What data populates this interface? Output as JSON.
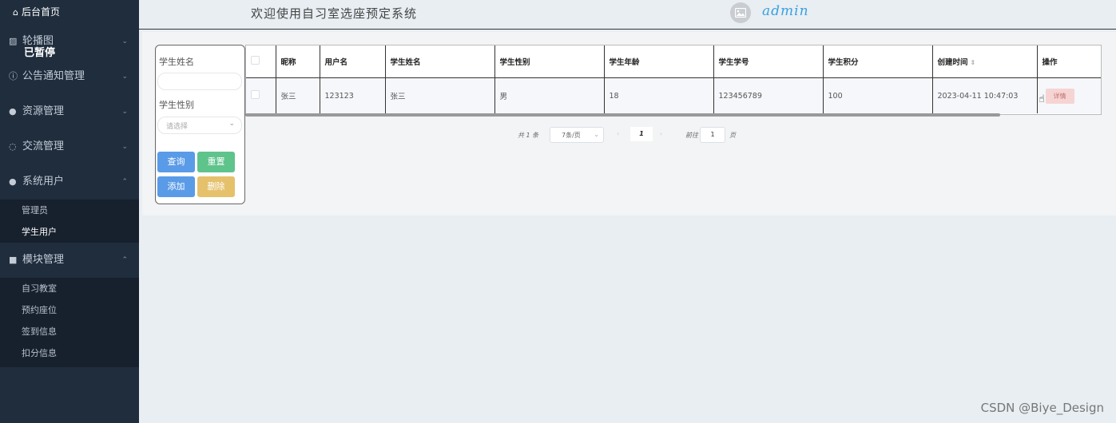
{
  "sidebar": {
    "home": "后台首页",
    "paused": "已暂停",
    "groups": [
      {
        "label": "轮播图",
        "icon": "image-icon"
      },
      {
        "label": "公告通知管理",
        "icon": "info-icon"
      },
      {
        "label": "资源管理",
        "icon": "location-icon"
      },
      {
        "label": "交流管理",
        "icon": "chat-icon"
      },
      {
        "label": "系统用户",
        "icon": "user-icon"
      },
      {
        "label": "模块管理",
        "icon": "grid-icon"
      }
    ],
    "system_users_items": [
      "管理员",
      "学生用户"
    ],
    "module_items": [
      "自习教室",
      "预约座位",
      "签到信息",
      "扣分信息"
    ]
  },
  "header": {
    "welcome": "欢迎使用自习室选座预定系统",
    "username": "admin"
  },
  "search": {
    "name_label": "学生姓名",
    "gender_label": "学生性别",
    "gender_placeholder": "请选择",
    "query_label": "查询",
    "reset_label": "重置",
    "add_label": "添加",
    "delete_label": "删除"
  },
  "table": {
    "headers": [
      "昵称",
      "用户名",
      "学生姓名",
      "学生性别",
      "学生年龄",
      "学生学号",
      "学生积分",
      "创建时间",
      "操作"
    ],
    "rows": [
      {
        "nickname": "张三",
        "username": "123123",
        "name": "张三",
        "gender": "男",
        "age": "18",
        "student_no": "123456789",
        "points": "100",
        "created": "2023-04-11 10:47:03",
        "action": "详情"
      }
    ]
  },
  "pagination": {
    "total": "共 1 条",
    "page_size": "7条/页",
    "current": "1",
    "goto": "前往",
    "jump_value": "1",
    "page_unit": "页"
  },
  "watermark": "CSDN @Biye_Design"
}
